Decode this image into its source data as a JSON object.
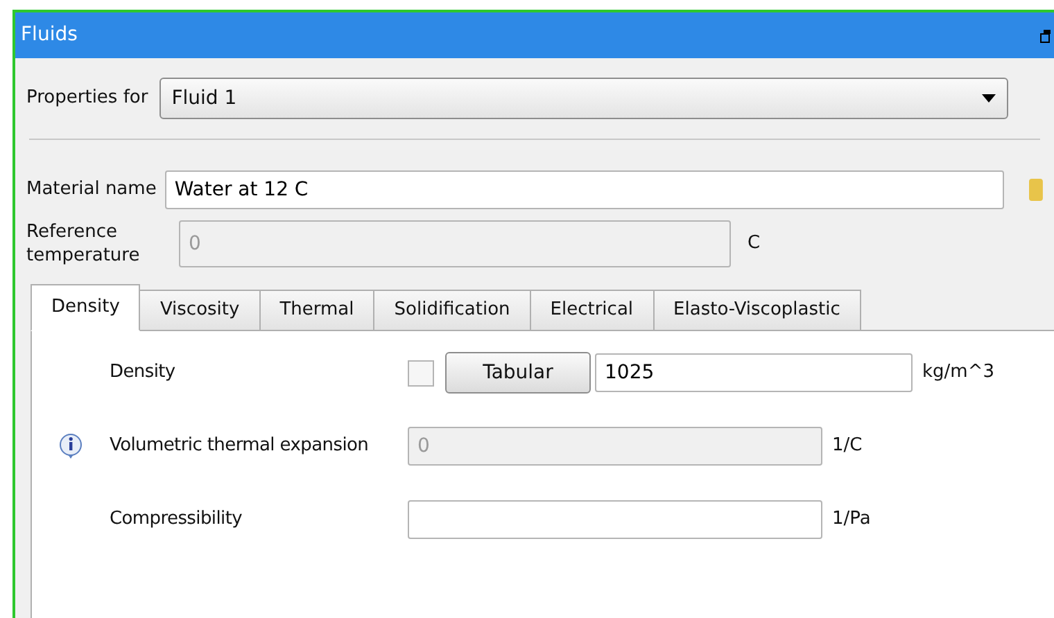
{
  "window": {
    "title": "Fluids"
  },
  "properties_for": {
    "label": "Properties for",
    "value": "Fluid 1"
  },
  "material_name": {
    "label": "Material name",
    "value": "Water at 12 C"
  },
  "reference_temperature": {
    "label": "Reference temperature",
    "value": "0",
    "unit": "C",
    "disabled": true
  },
  "tabs": [
    {
      "label": "Density",
      "selected": true
    },
    {
      "label": "Viscosity",
      "selected": false
    },
    {
      "label": "Thermal",
      "selected": false
    },
    {
      "label": "Solidification",
      "selected": false
    },
    {
      "label": "Electrical",
      "selected": false
    },
    {
      "label": "Elasto-Viscoplastic",
      "selected": false
    }
  ],
  "rows": [
    {
      "label": "Density",
      "checked": false,
      "button": "Tabular",
      "value": "1025",
      "unit": "kg/m^3",
      "disabled": false,
      "info": false
    },
    {
      "label": "Volumetric thermal expansion",
      "value": "0",
      "unit": "1/C",
      "disabled": true,
      "info": true
    },
    {
      "label": "Compressibility",
      "unit": "1/Pa",
      "disabled": false,
      "info": false
    }
  ]
}
